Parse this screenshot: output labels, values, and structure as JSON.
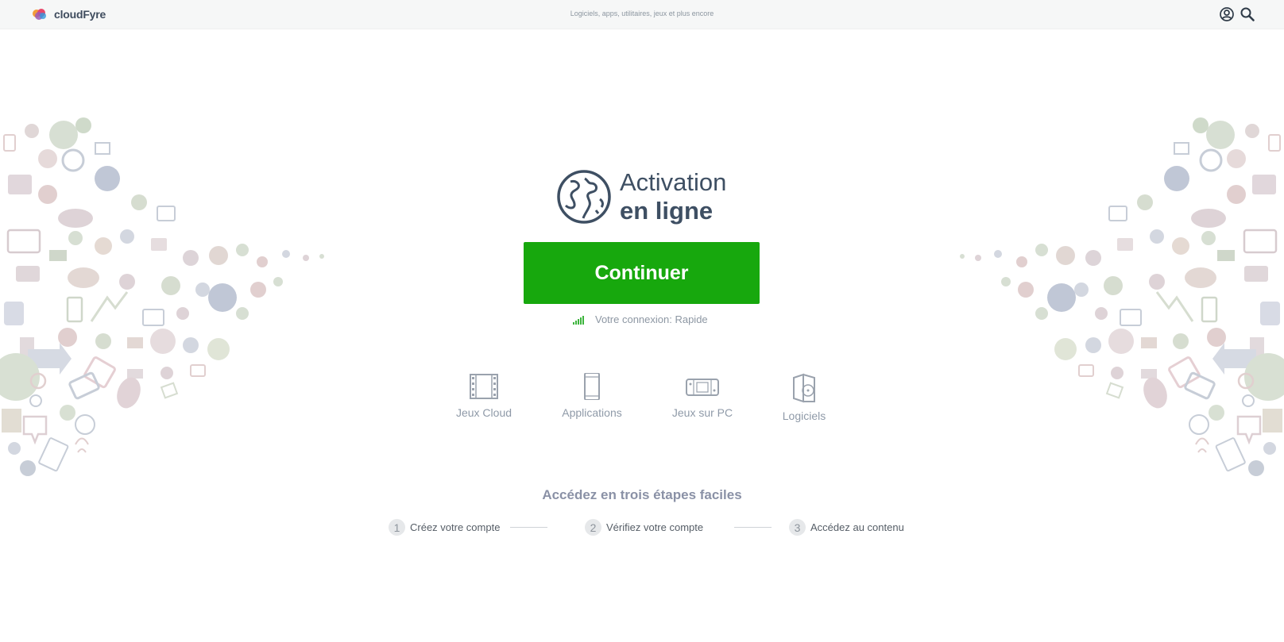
{
  "header": {
    "brand": "cloudFyre",
    "tagline": "Logiciels, apps, utilitaires, jeux et plus encore",
    "account_icon": "user-circle-icon",
    "search_icon": "search-icon"
  },
  "hero": {
    "icon": "globe-icon",
    "title_line1": "Activation",
    "title_line2": "en ligne"
  },
  "cta": {
    "label": "Continuer",
    "color": "#17a80d"
  },
  "connection": {
    "icon": "signal-bars-icon",
    "text": "Votre connexion: Rapide"
  },
  "categories": [
    {
      "label": "Jeux Cloud",
      "icon": "film-strip-icon"
    },
    {
      "label": "Applications",
      "icon": "smartphone-icon"
    },
    {
      "label": "Jeux sur PC",
      "icon": "gamepad-icon"
    },
    {
      "label": "Logiciels",
      "icon": "software-box-icon"
    }
  ],
  "steps": {
    "title": "Accédez en trois étapes faciles",
    "items": [
      {
        "num": "1",
        "label": "Créez votre compte"
      },
      {
        "num": "2",
        "label": "Vérifiez votre compte"
      },
      {
        "num": "3",
        "label": "Accédez au contenu"
      }
    ]
  },
  "colors": {
    "accent": "#17a80d",
    "title": "#3e4f63",
    "muted": "#8f9aa8"
  }
}
